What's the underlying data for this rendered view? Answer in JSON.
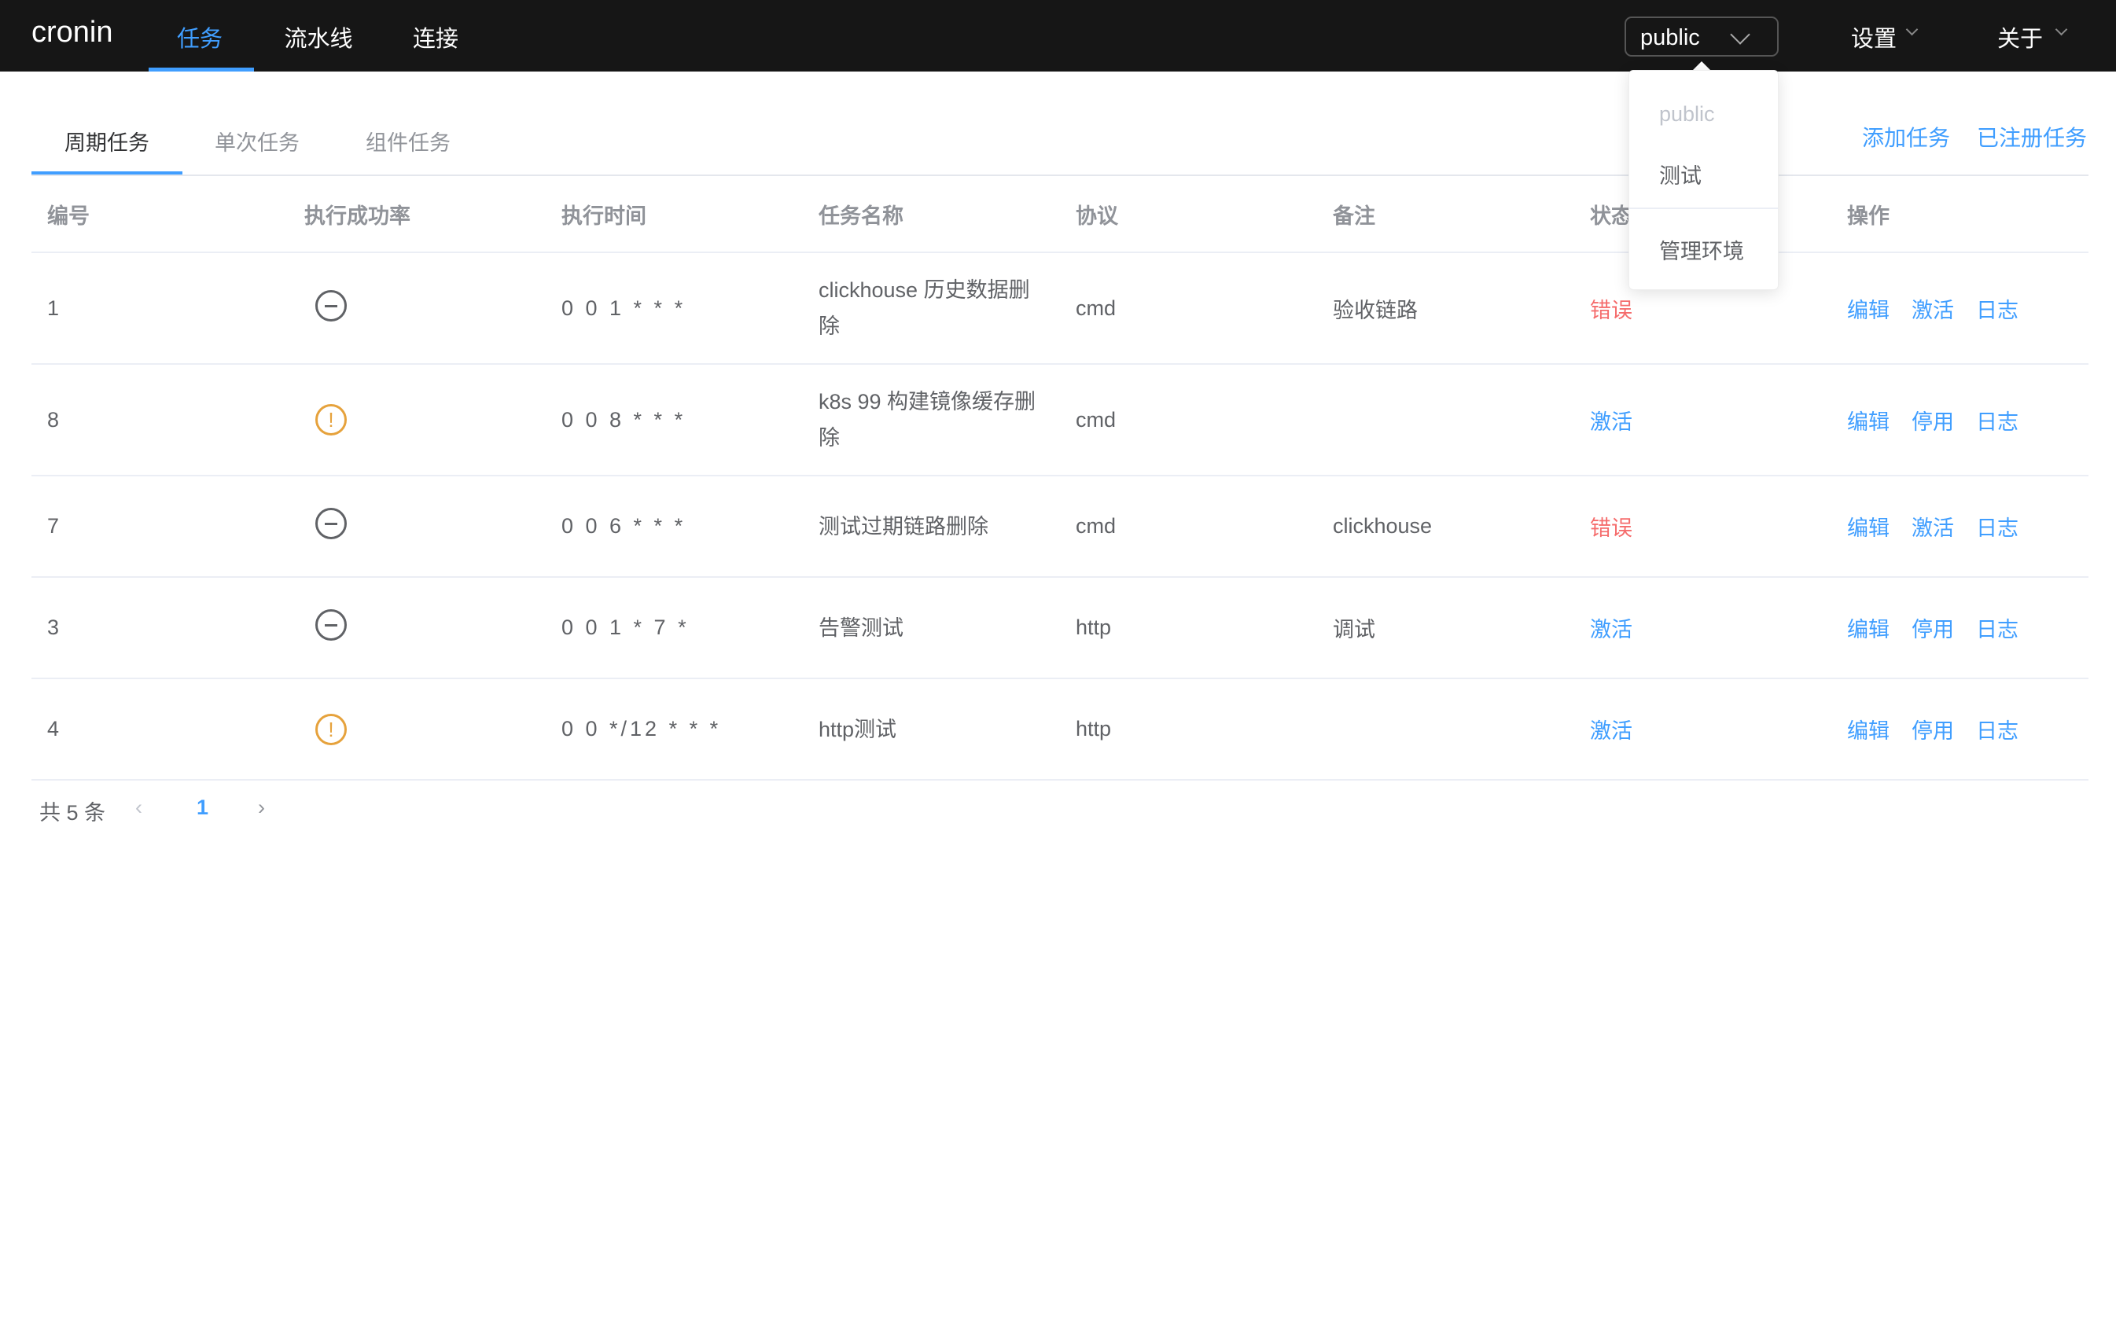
{
  "header": {
    "logo": "cronin",
    "nav": [
      {
        "label": "任务",
        "active": true
      },
      {
        "label": "流水线"
      },
      {
        "label": "连接"
      }
    ],
    "env_select": "public",
    "menus": [
      "设置",
      "关于"
    ]
  },
  "env_dropdown": {
    "items": [
      "public",
      "测试"
    ],
    "manage": "管理环境"
  },
  "tabs": [
    "周期任务",
    "单次任务",
    "组件任务"
  ],
  "actions": {
    "add": "添加任务",
    "registered": "已注册任务"
  },
  "table": {
    "columns": [
      "编号",
      "执行成功率",
      "执行时间",
      "任务名称",
      "协议",
      "备注",
      "状态",
      "操作"
    ],
    "rows": [
      {
        "id": "1",
        "rate_icon": "minus-circle",
        "cron": "0 0 1 * * *",
        "name": "clickhouse 历史数据删除",
        "protocol": "cmd",
        "note": "验收链路",
        "status": "错误",
        "status_color": "#f56c6c",
        "ops": [
          "编辑",
          "激活",
          "日志"
        ]
      },
      {
        "id": "8",
        "rate_icon": "warning-circle",
        "cron": "0 0 8 * * *",
        "name": "k8s 99 构建镜像缓存删除",
        "protocol": "cmd",
        "note": "",
        "status": "激活",
        "status_color": "#409eff",
        "ops": [
          "编辑",
          "停用",
          "日志"
        ]
      },
      {
        "id": "7",
        "rate_icon": "minus-circle",
        "cron": "0 0 6 * * *",
        "name": "测试过期链路删除",
        "protocol": "cmd",
        "note": "clickhouse",
        "status": "错误",
        "status_color": "#f56c6c",
        "ops": [
          "编辑",
          "激活",
          "日志"
        ]
      },
      {
        "id": "3",
        "rate_icon": "minus-circle",
        "cron": "0 0 1 * 7 *",
        "name": "告警测试",
        "protocol": "http",
        "note": "调试",
        "status": "激活",
        "status_color": "#409eff",
        "ops": [
          "编辑",
          "停用",
          "日志"
        ]
      },
      {
        "id": "4",
        "rate_icon": "warning-circle",
        "cron": "0 0 */12 * * *",
        "name": "http测试",
        "protocol": "http",
        "note": "",
        "status": "激活",
        "status_color": "#409eff",
        "ops": [
          "编辑",
          "停用",
          "日志"
        ]
      }
    ]
  },
  "pagination": {
    "total": "共 5 条",
    "page": "1",
    "prev": "‹",
    "next": "›"
  }
}
